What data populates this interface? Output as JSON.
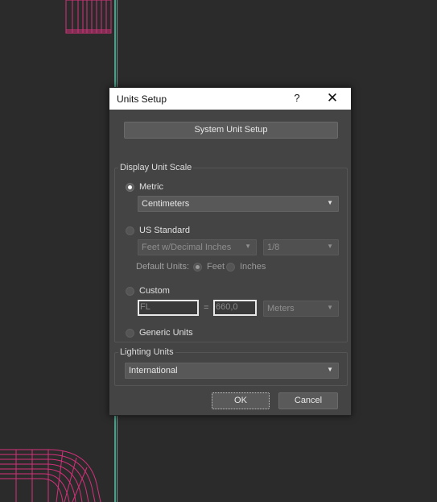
{
  "dialog": {
    "title": "Units Setup",
    "help_label": "?",
    "close_label": "✕",
    "system_unit_setup_label": "System Unit Setup"
  },
  "display_unit_scale": {
    "group_label": "Display Unit Scale",
    "metric": {
      "label": "Metric",
      "selected": true,
      "dropdown_value": "Centimeters"
    },
    "us_standard": {
      "label": "US Standard",
      "selected": false,
      "dropdown_value": "Feet w/Decimal Inches",
      "fraction_value": "1/8",
      "default_units_label": "Default Units:",
      "feet_label": "Feet",
      "inches_label": "Inches"
    },
    "custom": {
      "label": "Custom",
      "selected": false,
      "name_value": "FL",
      "equals": "=",
      "amount_value": "660,0",
      "unit_value": "Meters"
    },
    "generic": {
      "label": "Generic Units",
      "selected": false
    }
  },
  "lighting_units": {
    "group_label": "Lighting Units",
    "dropdown_value": "International"
  },
  "footer": {
    "ok_label": "OK",
    "cancel_label": "Cancel"
  },
  "icons": {
    "dropdown": "▼"
  },
  "colors": {
    "viewport_bg": "#2b2b2b",
    "dialog_bg": "#444444",
    "wireframe": "#d4307a",
    "guide_line": "#5fb7a0"
  }
}
